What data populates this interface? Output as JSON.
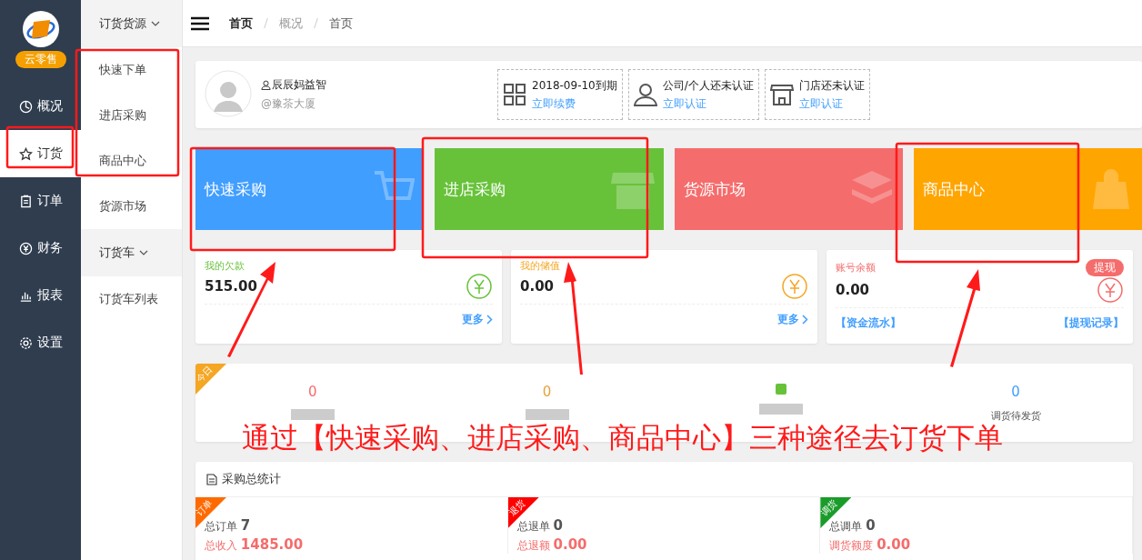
{
  "brand": {
    "badge": "云零售"
  },
  "nav": [
    {
      "label": "概况",
      "selected": false
    },
    {
      "label": "订货",
      "selected": true
    },
    {
      "label": "订单",
      "selected": false
    },
    {
      "label": "财务",
      "selected": false
    },
    {
      "label": "报表",
      "selected": false
    },
    {
      "label": "设置",
      "selected": false
    }
  ],
  "submenu": [
    {
      "title": "订货货源",
      "expanded": true,
      "items": [
        "快速下单",
        "进店采购",
        "商品中心",
        "货源市场"
      ]
    },
    {
      "title": "订货车",
      "expanded": true,
      "items": [
        "订货车列表"
      ]
    }
  ],
  "breadcrumb": [
    "首页",
    "概况",
    "首页"
  ],
  "profile": {
    "name": "辰辰妈益智",
    "shop": "@豫茶大厦"
  },
  "notices": [
    {
      "kind": "grid",
      "text": "2018-09-10到期",
      "link": "立即续费"
    },
    {
      "kind": "person",
      "text": "公司/个人还未认证",
      "link": "立即认证"
    },
    {
      "kind": "store",
      "text": "门店还未认证",
      "link": "立即认证"
    }
  ],
  "tiles": [
    {
      "kind": "cart",
      "label": "快速采购",
      "color": "#409eff"
    },
    {
      "kind": "shop",
      "label": "进店采购",
      "color": "#67c23a"
    },
    {
      "kind": "layers",
      "label": "货源市场",
      "color": "#f56c6c"
    },
    {
      "kind": "bag",
      "label": "商品中心",
      "color": "#ffa500"
    }
  ],
  "accounts": [
    {
      "title": "我的欠款",
      "amount": "515.00",
      "color": "#67c23a",
      "links": [
        "更多"
      ]
    },
    {
      "title": "我的储值",
      "amount": "0.00",
      "color": "#f5a623",
      "links": [
        "更多"
      ]
    },
    {
      "title": "账号余额",
      "amount": "0.00",
      "color": "#f56c6c",
      "links": [
        "【资金流水】",
        "【提现记录】"
      ],
      "action": "提现"
    }
  ],
  "today": {
    "ribbon": "今日",
    "items": [
      {
        "value": "0",
        "color": "#f56c6c"
      },
      {
        "value": "0",
        "color": "#e6a23c"
      },
      {
        "color": "#67c23a"
      },
      {
        "value": "0",
        "label": "调货待发货",
        "color": "#409eff"
      }
    ]
  },
  "stats": {
    "title": "采购总统计",
    "groups": [
      {
        "ribbon": "订单",
        "color": "#ff6a00",
        "count_label": "总订单",
        "count": "7",
        "amount_label": "总收入",
        "amount": "1485.00"
      },
      {
        "ribbon": "退货",
        "color": "#ff0000",
        "count_label": "总退单",
        "count": "0",
        "amount_label": "总退额",
        "amount": "0.00"
      },
      {
        "ribbon": "调货",
        "color": "#1a9c2a",
        "count_label": "总调单",
        "count": "0",
        "amount_label": "调货额度",
        "amount": "0.00"
      }
    ]
  },
  "annotation": "通过【快速采购、进店采购、商品中心】三种途径去订货下单"
}
